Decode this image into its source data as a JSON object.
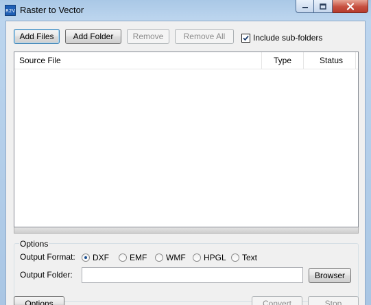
{
  "window": {
    "title": "Raster to Vector",
    "app_icon_text": "R2V"
  },
  "toolbar": {
    "add_files": "Add Files",
    "add_folder": "Add Folder",
    "remove": "Remove",
    "remove_all": "Remove All",
    "include_subfolders": "Include sub-folders",
    "include_subfolders_checked": true
  },
  "file_list": {
    "columns": [
      "Source File",
      "Type",
      "Status"
    ],
    "rows": []
  },
  "options": {
    "group_label": "Options",
    "output_format_label": "Output Format:",
    "formats": [
      "DXF",
      "EMF",
      "WMF",
      "HPGL",
      "Text"
    ],
    "selected_format": "DXF",
    "output_folder_label": "Output Folder:",
    "output_folder_value": "",
    "browse": "Browser"
  },
  "bottom": {
    "options": "Options",
    "convert": "Convert",
    "stop": "Stop"
  }
}
